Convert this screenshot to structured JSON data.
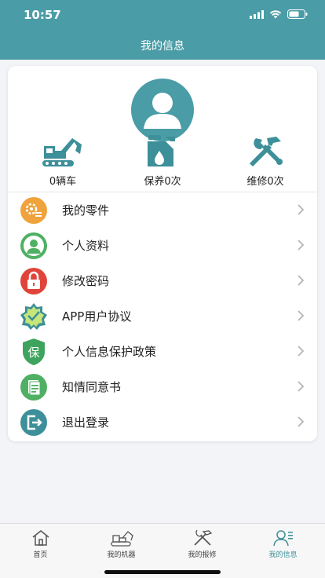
{
  "status_bar": {
    "time": "10:57"
  },
  "header": {
    "title": "我的信息"
  },
  "stats": [
    {
      "icon": "excavator-icon",
      "label": "0辆车"
    },
    {
      "icon": "oil-can-icon",
      "label": "保养0次"
    },
    {
      "icon": "tools-icon",
      "label": "维修0次"
    }
  ],
  "menu": [
    {
      "icon": "parts-icon",
      "label": "我的零件",
      "color": "#f0a23c"
    },
    {
      "icon": "person-icon",
      "label": "个人资料",
      "color": "#4fb063"
    },
    {
      "icon": "lock-icon",
      "label": "修改密码",
      "color": "#e0443a"
    },
    {
      "icon": "badge-check-icon",
      "label": "APP用户协议",
      "color": "#a4d35a"
    },
    {
      "icon": "shield-bao-icon",
      "label": "个人信息保护政策",
      "color": "#3ea45d",
      "icon_text": "保"
    },
    {
      "icon": "document-icon",
      "label": "知情同意书",
      "color": "#4fb063"
    },
    {
      "icon": "logout-icon",
      "label": "退出登录",
      "color": "#3d8f99"
    }
  ],
  "tabs": [
    {
      "icon": "home-icon",
      "label": "首页"
    },
    {
      "icon": "machine-icon",
      "label": "我的机器"
    },
    {
      "icon": "repair-icon",
      "label": "我的报修"
    },
    {
      "icon": "my-info-icon",
      "label": "我的信息",
      "active": true
    }
  ],
  "colors": {
    "primary": "#4a9ca6",
    "active_tab": "#3d8f99"
  }
}
